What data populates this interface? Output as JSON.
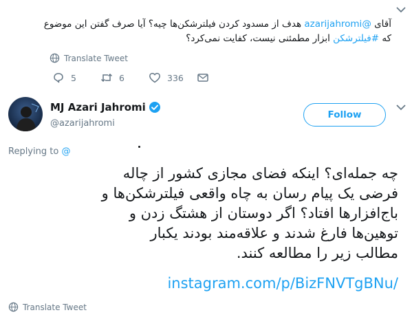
{
  "parent_tweet": {
    "line1_prefix": "آقای",
    "mention": "@azarijahromi",
    "line1_rest": "هدف از مسدود کردن فیلترشکن‌ها چیه؟ آیا صرف گفتن این موضوع",
    "line2_prefix": "که",
    "hashtag": "#فیلترشکن",
    "line2_rest": "ابزار مطمئنی نیست، کفایت نمی‌کرد؟",
    "translate_label": "Translate Tweet",
    "replies": "5",
    "retweets": "6",
    "likes": "336"
  },
  "main_tweet": {
    "display_name": "MJ Azari Jahromi",
    "handle": "@azarijahromi",
    "follow_label": "Follow",
    "replying_prefix": "Replying to",
    "replying_to": "@",
    "lines": [
      "چه جمله‌ای؟ اینکه فضای مجازی کشور از چاله",
      "فرضی یک پیام رسان  به چاه واقعی فیلترشکن‌ها و",
      "باج‌افزارها افتاد؟ اگر دوستان از هشتگ زدن و",
      "توهین‌ها فارغ شدند و علاقه‌مند بودند یکبار",
      "مطالب زیر را مطالعه کنند."
    ],
    "url": "instagram.com/p/BizFNVTgBNu/",
    "translate_label": "Translate Tweet"
  },
  "colors": {
    "link": "#1da1f2",
    "muted": "#657786",
    "text": "#14171a"
  }
}
